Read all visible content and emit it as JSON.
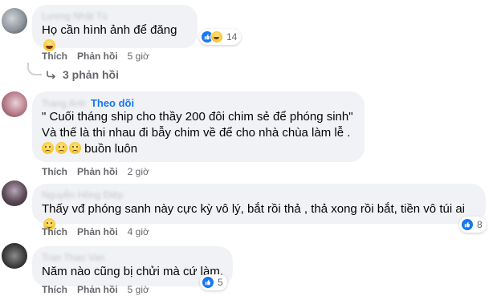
{
  "comments": [
    {
      "author": "Lương Nhật Tú",
      "text": "Họ cần hình ảnh để đăng",
      "emoji_after": [
        "laugh"
      ],
      "like_label": "Thích",
      "reply_label": "Phản hồi",
      "time": "5 giờ",
      "reaction_count": "14",
      "reply_thread": "3 phản hồi"
    },
    {
      "author": "Trang Anh",
      "follow_label": "Theo dõi",
      "text": "\" Cuối tháng ship cho thầy 200 đôi chim sẻ để phóng sinh\"\nVà thế là thi nhau đi bẫy chim về để cho nhà chùa làm lễ .",
      "last_line": "buồn luôn",
      "emoji_before_last": [
        "sad",
        "sad",
        "sad"
      ],
      "like_label": "Thích",
      "reply_label": "Phản hồi",
      "time": "2 giờ"
    },
    {
      "author": "Nguyễn Hồng Điệp",
      "text": "Thấy vđ phóng sanh này cực kỳ vô lý, bắt rồi thả , thả xong rồi bắt, tiền vô túi ai",
      "emoji_after": [
        "smile"
      ],
      "like_label": "Thích",
      "reply_label": "Phản hồi",
      "time": "4 giờ",
      "reaction_count": "8"
    },
    {
      "author": "Tran Thao Van",
      "text": "Năm nào cũng bị chửi mà cứ làm.",
      "like_label": "Thích",
      "reply_label": "Phản hồi",
      "time": "5 giờ",
      "reaction_count": "5"
    }
  ],
  "colors": {
    "bubble": "#f0f2f5",
    "link": "#1877f2",
    "meta": "#65676b"
  }
}
